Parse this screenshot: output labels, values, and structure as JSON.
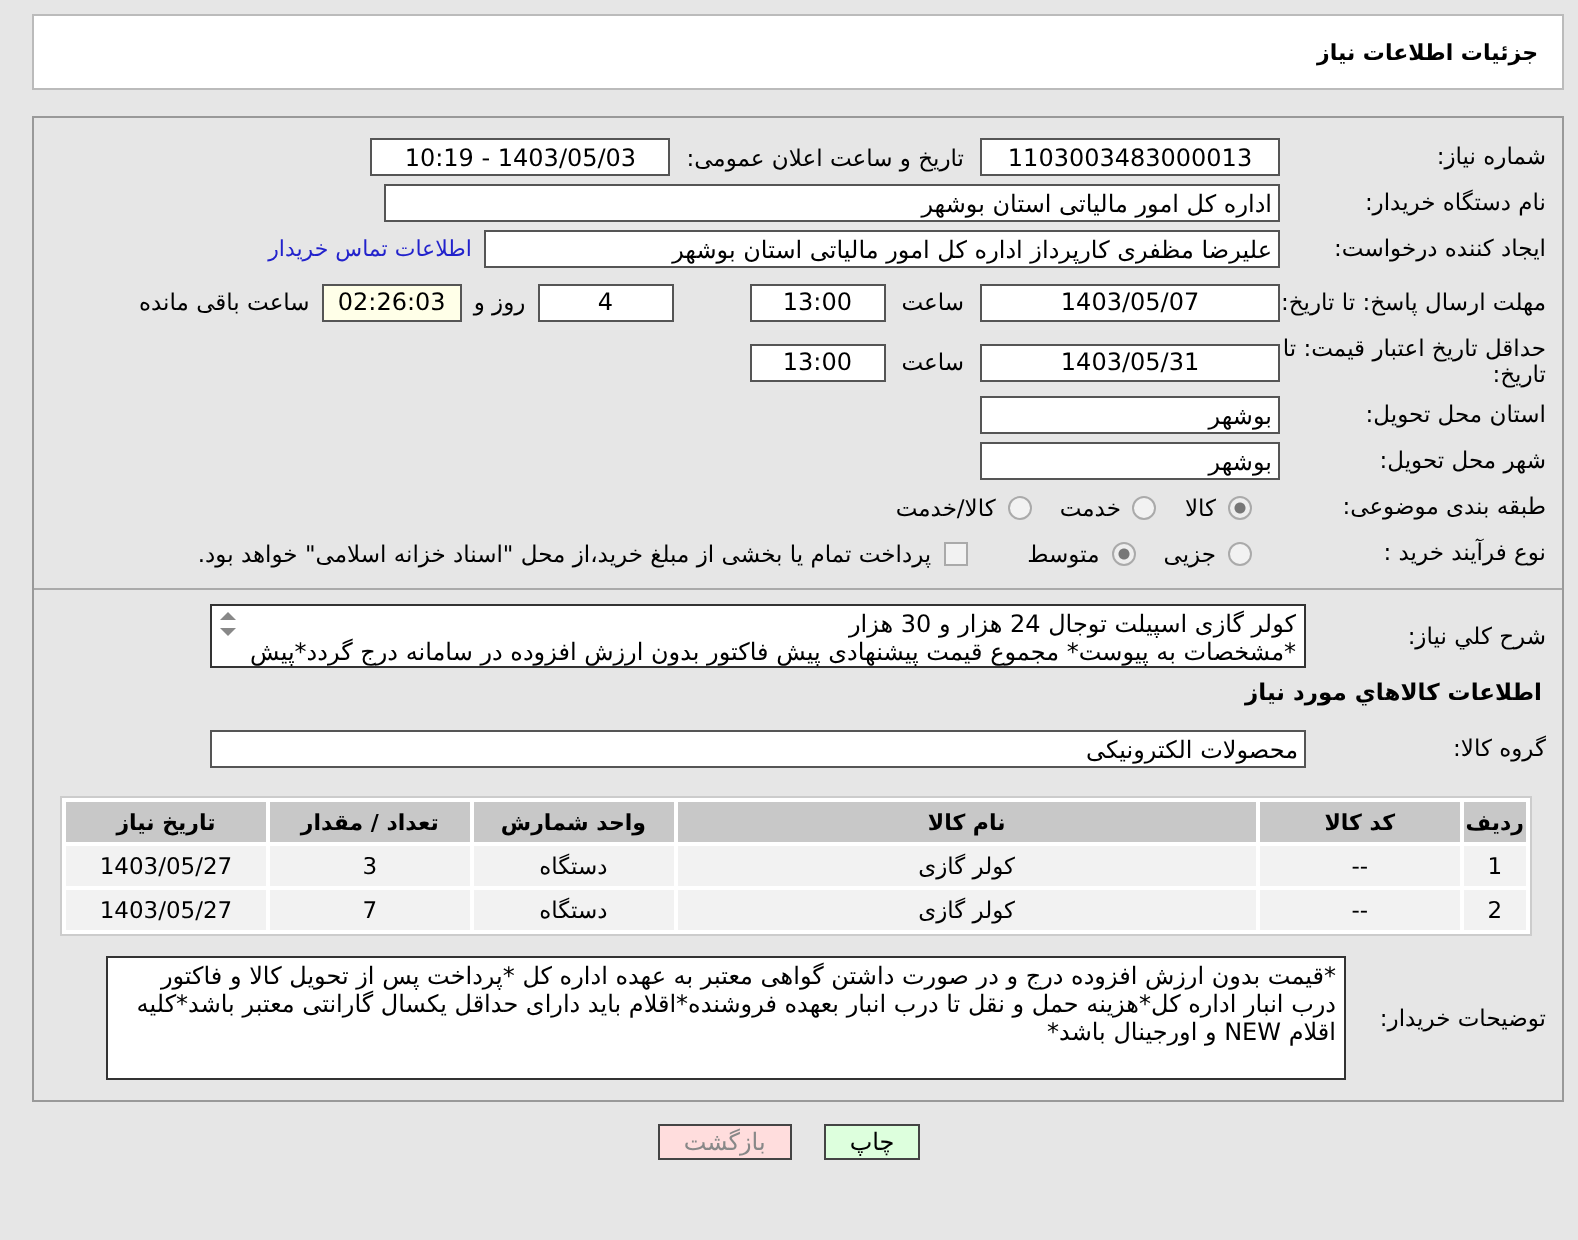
{
  "header": {
    "title": "جزئیات اطلاعات نیاز"
  },
  "fields": {
    "need_number": {
      "label": "شماره نیاز:",
      "value": "1103003483000013"
    },
    "announce": {
      "label": "تاریخ و ساعت اعلان عمومی:",
      "value": "1403/05/03 - 10:19"
    },
    "buyer_org": {
      "label": "نام دستگاه خریدار:",
      "value": "اداره کل امور مالیاتی استان بوشهر"
    },
    "requester": {
      "label": "ایجاد کننده درخواست:",
      "value": "علیرضا مظفری کارپرداز اداره کل امور مالیاتی استان بوشهر",
      "link": "اطلاعات تماس خریدار"
    },
    "deadline": {
      "label": "مهلت ارسال پاسخ: تا تاریخ:",
      "date": "1403/05/07",
      "time_label": "ساعت",
      "time": "13:00",
      "days": "4",
      "days_label": "روز و",
      "remaining": "02:26:03",
      "remaining_label": "ساعت باقی مانده"
    },
    "validity": {
      "label": "حداقل تاریخ اعتبار قیمت: تا تاریخ:",
      "date": "1403/05/31",
      "time_label": "ساعت",
      "time": "13:00"
    },
    "province": {
      "label": "استان محل تحویل:",
      "value": "بوشهر"
    },
    "city": {
      "label": "شهر محل تحویل:",
      "value": "بوشهر"
    },
    "category": {
      "label": "طبقه بندی موضوعی:",
      "options": [
        {
          "label": "کالا",
          "selected": true
        },
        {
          "label": "خدمت",
          "selected": false
        },
        {
          "label": "کالا/خدمت",
          "selected": false
        }
      ]
    },
    "process": {
      "label": "نوع فرآیند خرید :",
      "options": [
        {
          "label": "جزیی",
          "selected": false
        },
        {
          "label": "متوسط",
          "selected": true
        }
      ],
      "payment": {
        "checked": false,
        "label": "پرداخت تمام یا بخشی از مبلغ خرید،از محل \"اسناد خزانه اسلامی\" خواهد بود."
      }
    }
  },
  "summary": {
    "label": "شرح کلي نياز:",
    "lines": [
      "کولر گازی اسپیلت توجال 24 هزار و 30 هزار",
      "*مشخصات به پیوست* مجموع قیمت پیشنهادی پیش فاکتور بدون ارزش افزوده در سامانه درج گردد*پیش"
    ]
  },
  "goods_title": "اطلاعات کالاهاي مورد نياز",
  "group": {
    "label": "گروه کالا:",
    "value": "محصولات الکترونیکی"
  },
  "table": {
    "columns": [
      "ردیف",
      "کد کالا",
      "نام کالا",
      "واحد شمارش",
      "تعداد / مقدار",
      "تاریخ نیاز"
    ],
    "rows": [
      [
        "1",
        "--",
        "کولر گازی",
        "دستگاه",
        "3",
        "1403/05/27"
      ],
      [
        "2",
        "--",
        "کولر گازی",
        "دستگاه",
        "7",
        "1403/05/27"
      ]
    ]
  },
  "notes": {
    "label": "توضیحات خریدار:",
    "value": "*قیمت بدون ارزش افزوده درج و در صورت داشتن گواهی معتبر به عهده اداره کل *پرداخت پس از تحویل کالا و فاکتور درب انبار اداره کل*هزینه حمل و نقل تا درب انبار بعهده فروشنده*اقلام باید دارای حداقل یکسال گارانتی معتبر باشد*کلیه اقلام NEW و اورجینال باشد*"
  },
  "buttons": [
    {
      "label": "چاپ",
      "kind": "print"
    },
    {
      "label": "بازگشت",
      "kind": "back"
    }
  ]
}
